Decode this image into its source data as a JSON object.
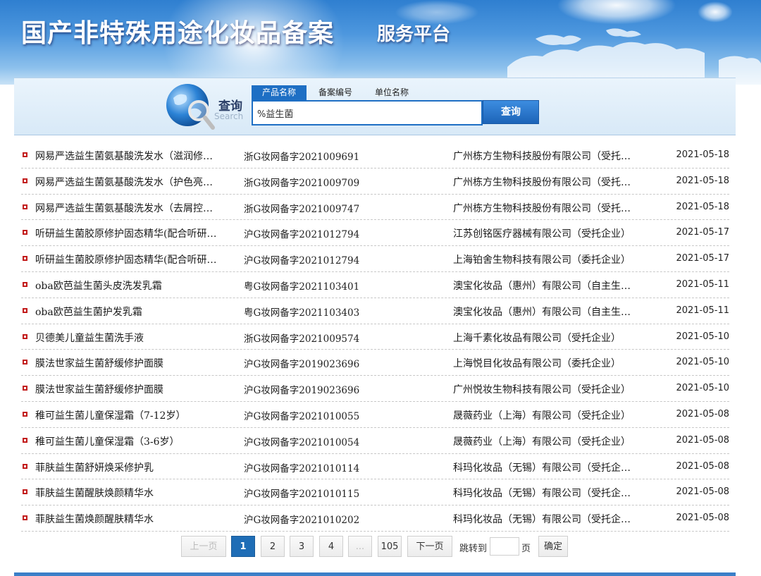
{
  "header": {
    "title": "国产非特殊用途化妆品备案",
    "subtitle": "服务平台"
  },
  "search": {
    "logo_title": "查询",
    "logo_sub": "Search",
    "tabs": [
      {
        "label": "产品名称",
        "active": true
      },
      {
        "label": "备案编号",
        "active": false
      },
      {
        "label": "单位名称",
        "active": false
      }
    ],
    "value": "%益生菌",
    "button_label": "查询"
  },
  "results": [
    {
      "name": "网易严选益生菌氨基酸洗发水（滋润修…",
      "code": "浙G妆网备字2021009691",
      "company": "广州栋方生物科技股份有限公司（受托…",
      "date": "2021-05-18"
    },
    {
      "name": "网易严选益生菌氨基酸洗发水（护色亮…",
      "code": "浙G妆网备字2021009709",
      "company": "广州栋方生物科技股份有限公司（受托…",
      "date": "2021-05-18"
    },
    {
      "name": "网易严选益生菌氨基酸洗发水（去屑控…",
      "code": "浙G妆网备字2021009747",
      "company": "广州栋方生物科技股份有限公司（受托…",
      "date": "2021-05-18"
    },
    {
      "name": "听研益生菌胶原修护固态精华(配合听研…",
      "code": "沪G妆网备字2021012794",
      "company": "江苏创铭医疗器械有限公司（受托企业）",
      "date": "2021-05-17"
    },
    {
      "name": "听研益生菌胶原修护固态精华(配合听研…",
      "code": "沪G妆网备字2021012794",
      "company": "上海铂舍生物科技有限公司（委托企业）",
      "date": "2021-05-17"
    },
    {
      "name": "oba欧芭益生菌头皮洗发乳霜",
      "code": "粤G妆网备字2021103401",
      "company": "澳宝化妆品（惠州）有限公司（自主生…",
      "date": "2021-05-11"
    },
    {
      "name": "oba欧芭益生菌护发乳霜",
      "code": "粤G妆网备字2021103403",
      "company": "澳宝化妆品（惠州）有限公司（自主生…",
      "date": "2021-05-11"
    },
    {
      "name": "贝德美儿童益生菌洗手液",
      "code": "浙G妆网备字2021009574",
      "company": "上海千素化妆品有限公司（受托企业）",
      "date": "2021-05-10"
    },
    {
      "name": "膜法世家益生菌舒缓修护面膜",
      "code": "沪G妆网备字2019023696",
      "company": "上海悦目化妆品有限公司（委托企业）",
      "date": "2021-05-10"
    },
    {
      "name": "膜法世家益生菌舒缓修护面膜",
      "code": "沪G妆网备字2019023696",
      "company": "广州悦妆生物科技有限公司（受托企业）",
      "date": "2021-05-10"
    },
    {
      "name": "稚可益生菌儿童保湿霜（7-12岁）",
      "code": "沪G妆网备字2021010055",
      "company": "晟薇药业（上海）有限公司（受托企业）",
      "date": "2021-05-08"
    },
    {
      "name": "稚可益生菌儿童保湿霜（3-6岁）",
      "code": "沪G妆网备字2021010054",
      "company": "晟薇药业（上海）有限公司（受托企业）",
      "date": "2021-05-08"
    },
    {
      "name": "菲肤益生菌舒妍焕采修护乳",
      "code": "沪G妆网备字2021010114",
      "company": "科玛化妆品（无锡）有限公司（受托企…",
      "date": "2021-05-08"
    },
    {
      "name": "菲肤益生菌醒肤焕颜精华水",
      "code": "沪G妆网备字2021010115",
      "company": "科玛化妆品（无锡）有限公司（受托企…",
      "date": "2021-05-08"
    },
    {
      "name": "菲肤益生菌焕颜醒肤精华水",
      "code": "沪G妆网备字2021010202",
      "company": "科玛化妆品（无锡）有限公司（受托企…",
      "date": "2021-05-08"
    }
  ],
  "pagination": {
    "prev_label": "上一页",
    "pages": [
      "1",
      "2",
      "3",
      "4",
      "...",
      "105"
    ],
    "current": "1",
    "next_label": "下一页",
    "jump_label": "跳转到",
    "page_unit": "页",
    "confirm_label": "确定"
  }
}
